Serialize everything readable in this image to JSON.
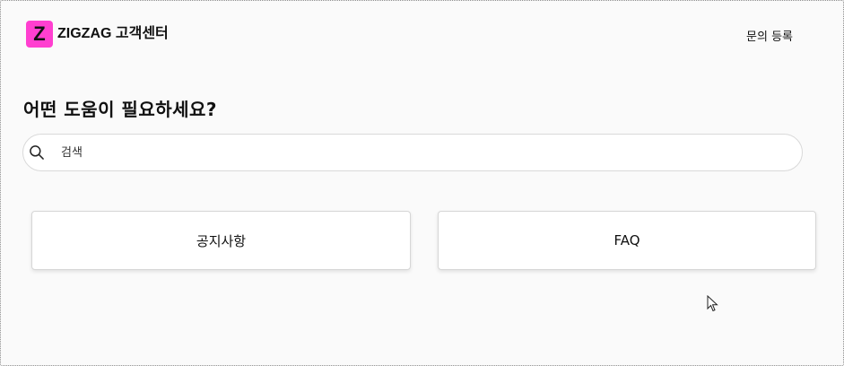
{
  "header": {
    "logo_letter": "Z",
    "brand_title": "ZIGZAG 고객센터",
    "inquiry_label": "문의 등록"
  },
  "main": {
    "heading": "어떤 도움이 필요하세요?",
    "search": {
      "placeholder": "검색",
      "value": ""
    },
    "cards": [
      {
        "label": "공지사항"
      },
      {
        "label": "FAQ"
      }
    ]
  },
  "colors": {
    "logo_bg": "#ff3fd0",
    "text": "#111111"
  }
}
